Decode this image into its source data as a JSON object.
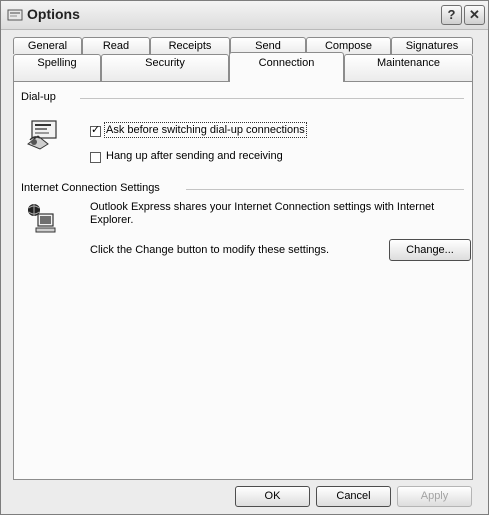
{
  "window": {
    "title": "Options"
  },
  "title_buttons": {
    "help": "?",
    "close": "✕"
  },
  "tabs_top": [
    "General",
    "Read",
    "Receipts",
    "Send",
    "Compose",
    "Signatures"
  ],
  "tabs_bottom": [
    "Spelling",
    "Security",
    "Connection",
    "Maintenance"
  ],
  "active_tab": "Connection",
  "dialup": {
    "heading": "Dial-up",
    "ask_before_switching": {
      "label": "Ask before switching dial-up connections",
      "checked": true
    },
    "hang_up": {
      "label": "Hang up after sending and receiving",
      "checked": false
    }
  },
  "internet": {
    "heading": "Internet Connection Settings",
    "description": "Outlook Express shares your Internet Connection settings with Internet Explorer.",
    "instruction": "Click the Change button to modify these settings.",
    "change_button": "Change..."
  },
  "footer": {
    "ok": "OK",
    "cancel": "Cancel",
    "apply": "Apply"
  }
}
